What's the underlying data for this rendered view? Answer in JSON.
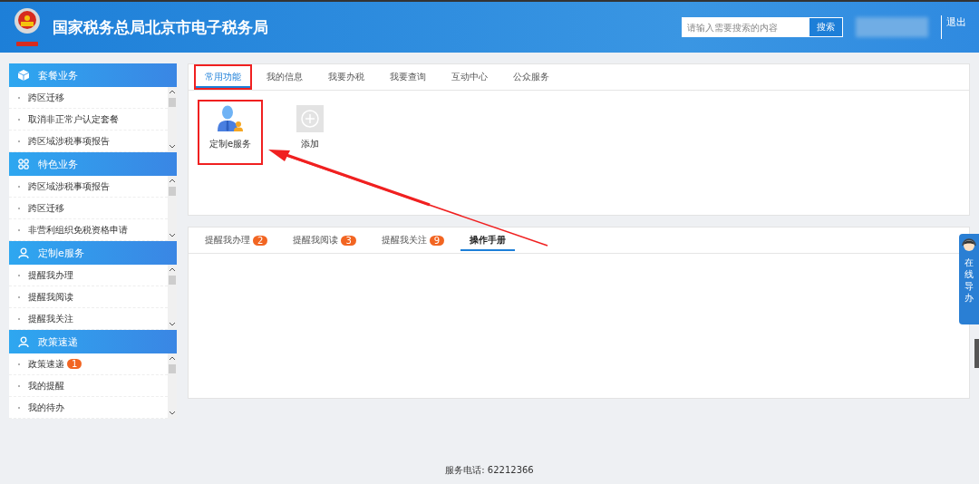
{
  "header": {
    "title": "国家税务总局北京市电子税务局",
    "search": {
      "placeholder": "请输入需要搜索的内容",
      "button": "搜索"
    },
    "logout": "退出"
  },
  "sidebar": [
    {
      "title": "套餐业务",
      "kind": "cube",
      "items": [
        "跨区迁移",
        "取消非正常户认定套餐",
        "跨区域涉税事项报告"
      ]
    },
    {
      "title": "特色业务",
      "kind": "grid",
      "items": [
        "跨区域涉税事项报告",
        "跨区迁移",
        "非营利组织免税资格申请"
      ]
    },
    {
      "title": "定制e服务",
      "kind": "user",
      "items": [
        "提醒我办理",
        "提醒我阅读",
        "提醒我关注"
      ]
    },
    {
      "title": "政策速递",
      "kind": "user",
      "items": [
        "政策速递",
        "我的提醒",
        "我的待办"
      ],
      "badge": "1"
    }
  ],
  "tabs": [
    {
      "label": "常用功能",
      "selected": true,
      "highlighted": true
    },
    {
      "label": "我的信息",
      "selected": false,
      "highlighted": false
    },
    {
      "label": "我要办税",
      "selected": false,
      "highlighted": false
    },
    {
      "label": "我要查询",
      "selected": false,
      "highlighted": false
    },
    {
      "label": "互动中心",
      "selected": false,
      "highlighted": false
    },
    {
      "label": "公众服务",
      "selected": false,
      "highlighted": false
    }
  ],
  "tiles": [
    {
      "label": "定制e服务",
      "kind": "service",
      "highlighted": true
    },
    {
      "label": "添加",
      "kind": "add",
      "highlighted": false
    }
  ],
  "reminder_tabs": [
    {
      "label": "提醒我办理",
      "count": "2",
      "selected": false
    },
    {
      "label": "提醒我阅读",
      "count": "3",
      "selected": false
    },
    {
      "label": "提醒我关注",
      "count": "9",
      "selected": false
    },
    {
      "label": "操作手册",
      "selected": true
    }
  ],
  "guide": {
    "label": "在线导办"
  },
  "footer": "服务电话: 62212366"
}
